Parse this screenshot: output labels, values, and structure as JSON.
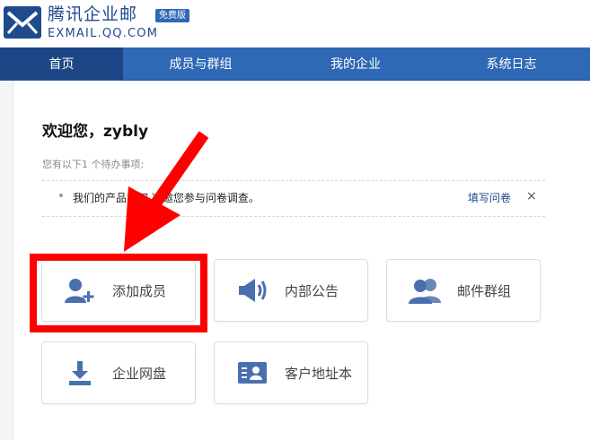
{
  "header": {
    "brand_name": "腾讯企业邮",
    "badge": "免费版",
    "domain": "EXMAIL.QQ.COM",
    "brand_color": "#1f4a8c"
  },
  "nav": {
    "tabs": [
      {
        "label": "首页",
        "active": true
      },
      {
        "label": "成员与群组",
        "active": false
      },
      {
        "label": "我的企业",
        "active": false
      },
      {
        "label": "系统日志",
        "active": false
      }
    ],
    "bar_color": "#2f68b4",
    "active_color": "#1d4686"
  },
  "main": {
    "welcome": "欢迎您，zybly",
    "todo_label": "您有以下1 个待办事项:",
    "todo_item": {
      "text": "我们的产品如何 减邀您参与问卷调查。",
      "link": "填写问卷",
      "close": "×"
    },
    "tiles": [
      {
        "label": "添加成员",
        "icon": "add-user-icon"
      },
      {
        "label": "内部公告",
        "icon": "speaker-icon"
      },
      {
        "label": "邮件群组",
        "icon": "group-icon"
      },
      {
        "label": "企业网盘",
        "icon": "download-icon"
      },
      {
        "label": "客户地址本",
        "icon": "contact-card-icon"
      }
    ]
  },
  "annotation": {
    "color": "#ff0000",
    "target": "添加成员"
  }
}
